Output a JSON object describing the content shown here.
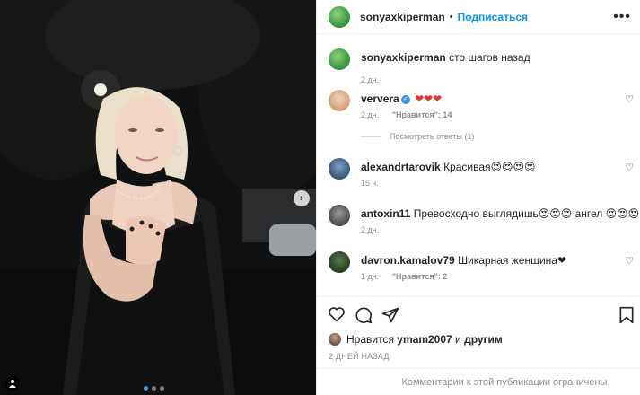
{
  "header": {
    "username": "sonyaxkiperman",
    "separator": "•",
    "follow_label": "Подписаться",
    "more_label": "•••"
  },
  "caption": {
    "username": "sonyaxkiperman",
    "text": "сто шагов назад",
    "time": "2 дн."
  },
  "comments": [
    {
      "username": "ververa",
      "verified": true,
      "text": "❤❤❤",
      "time": "2 дн.",
      "likes": "\"Нравится\": 14",
      "replies": "Посмотреть ответы (1)"
    },
    {
      "username": "alexandrtarovik",
      "text": "Красивая😍😍😍😍",
      "time": "15 ч."
    },
    {
      "username": "antoxin11",
      "text": "Превосходно выглядишь😍😍😍 ангел 😍😍😍",
      "time": "2 дн."
    },
    {
      "username": "davron.kamalov79",
      "text": "Шикарная женщина❤",
      "time": "1 дн.",
      "likes": "\"Нравится\": 2"
    }
  ],
  "likes": {
    "prefix": "Нравится",
    "user": "ymam2007",
    "conj": "и",
    "others": "другим"
  },
  "date": "2 ДНЕЙ НАЗАД",
  "footer": "Комментарии к этой публикации ограничены.",
  "carousel": {
    "next_label": "›",
    "slide_count": 3,
    "active_slide": 1
  },
  "colors": {
    "accent": "#0095f6",
    "text": "#262626",
    "muted": "#8e8e8e",
    "heart": "#e0362c"
  }
}
